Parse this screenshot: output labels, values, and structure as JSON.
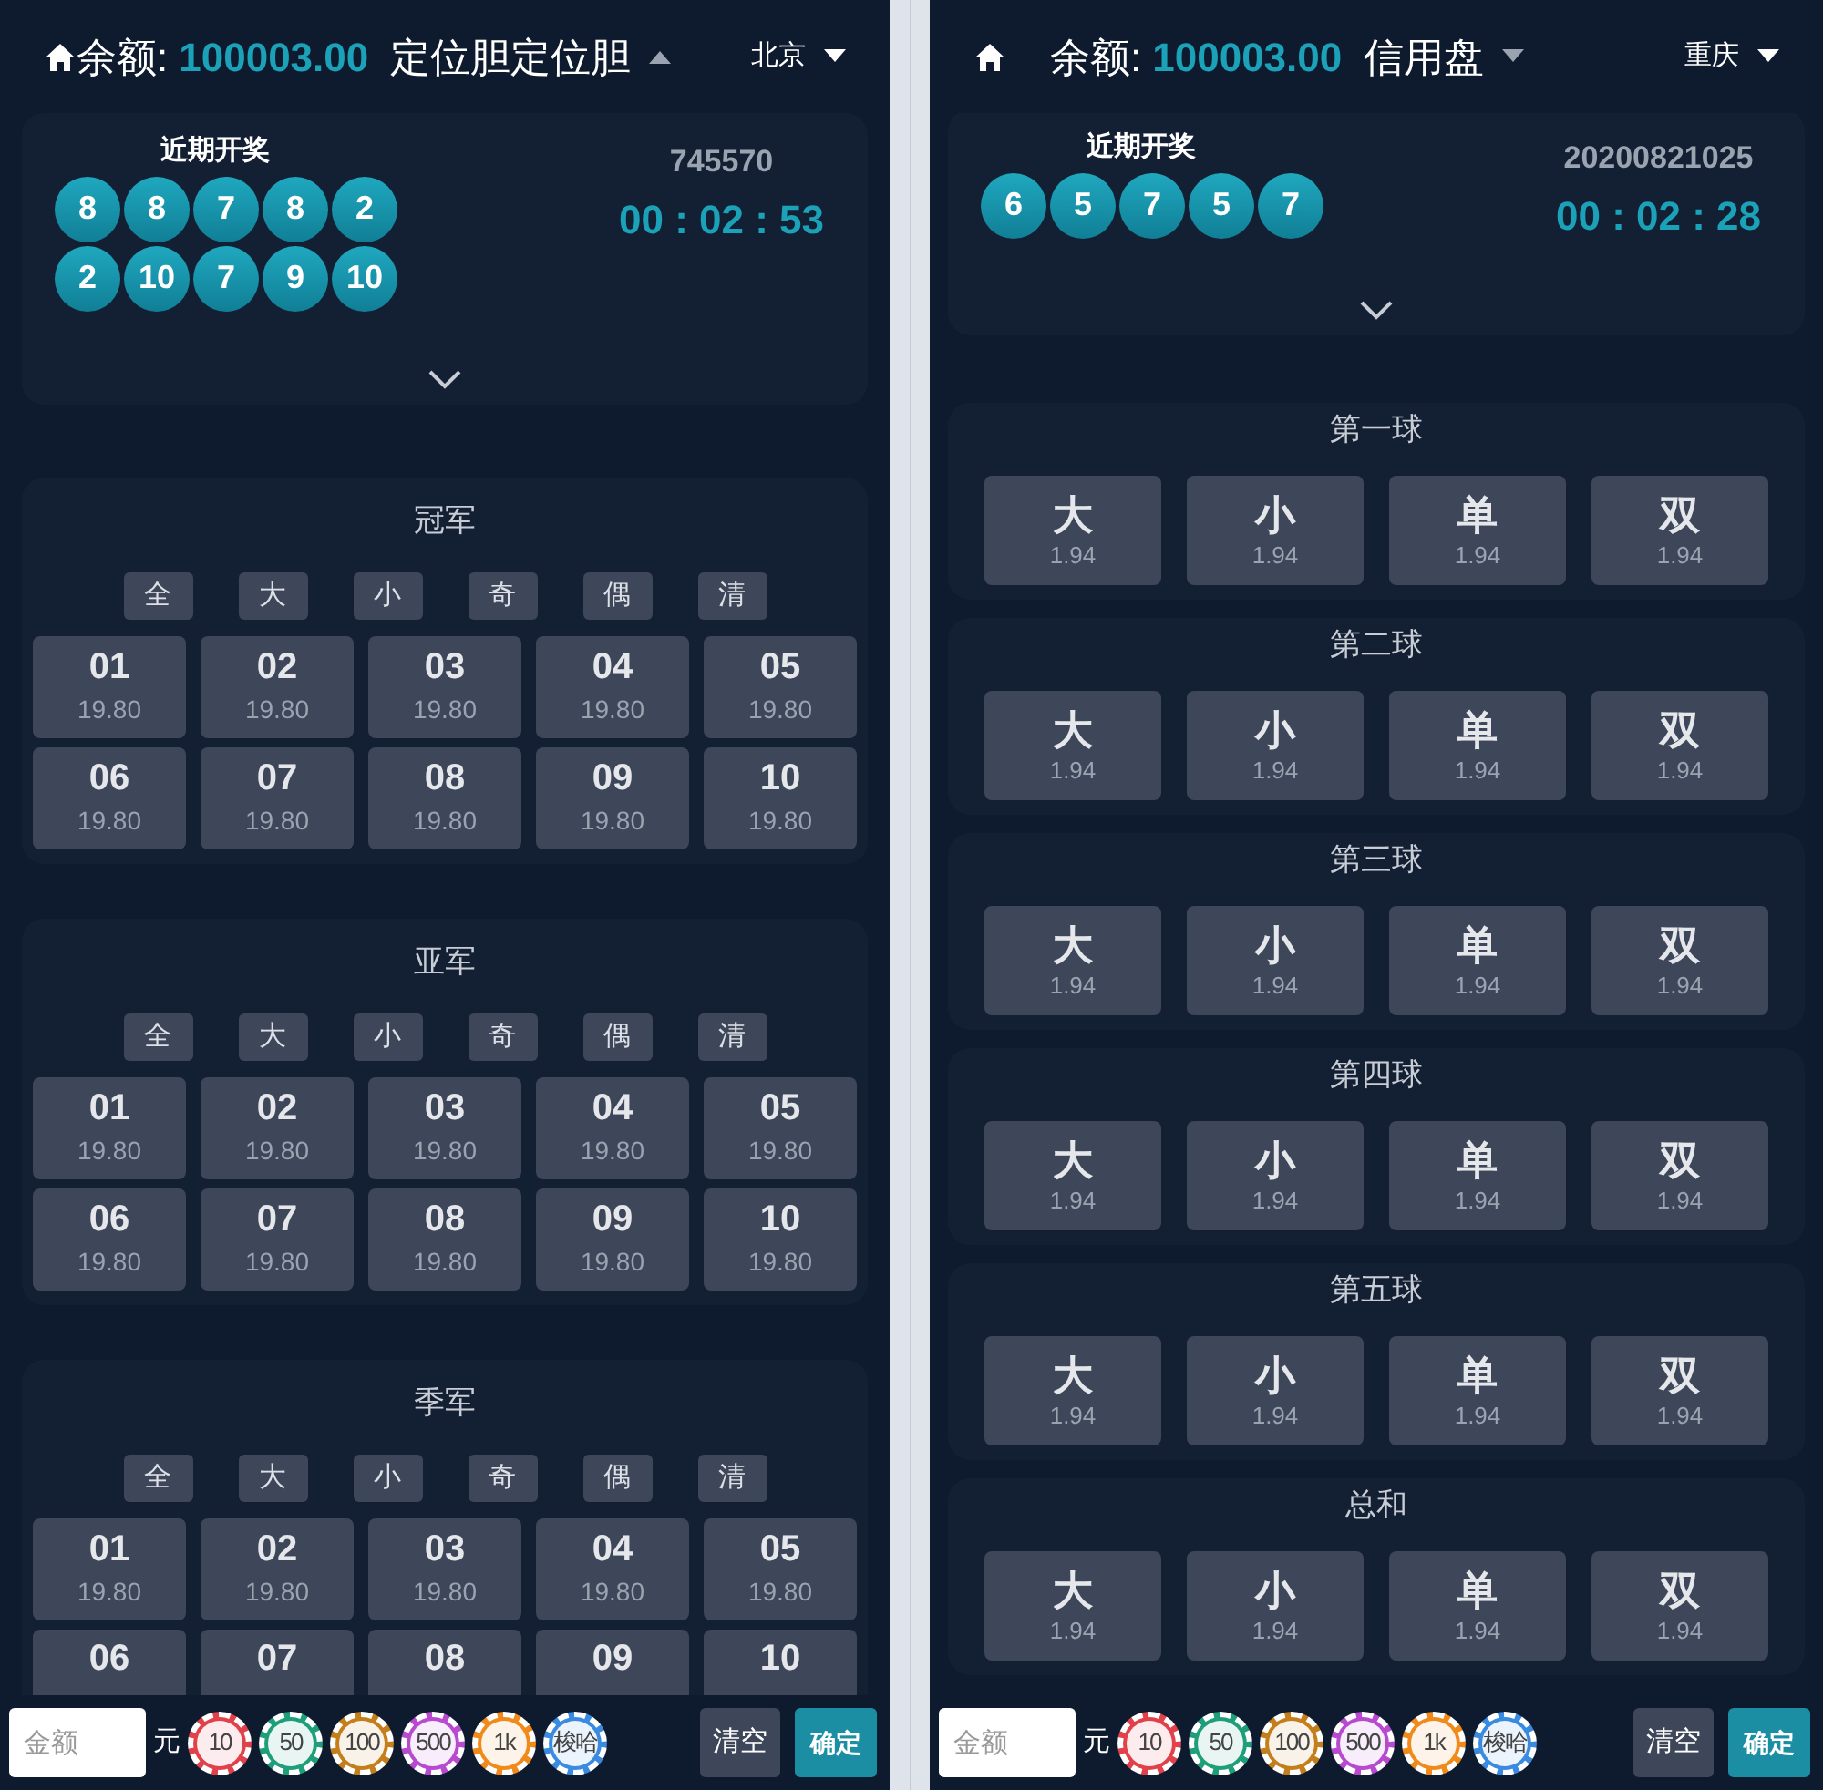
{
  "screens": [
    {
      "header": {
        "balance_label": "余额:",
        "balance": "100003.00",
        "mode": "定位胆定位胆",
        "mode_menu_expanded": true,
        "city": "北京"
      },
      "draw": {
        "title": "近期开奖",
        "numbers": [
          "8",
          "8",
          "7",
          "8",
          "2",
          "2",
          "10",
          "7",
          "9",
          "10"
        ],
        "issue": "745570",
        "countdown": "00 : 02 : 53"
      },
      "sections": [
        {
          "kind": "grid",
          "title": "冠军",
          "quick": [
            "全",
            "大",
            "小",
            "奇",
            "偶",
            "清"
          ],
          "options": [
            {
              "label": "01",
              "odds": "19.80"
            },
            {
              "label": "02",
              "odds": "19.80"
            },
            {
              "label": "03",
              "odds": "19.80"
            },
            {
              "label": "04",
              "odds": "19.80"
            },
            {
              "label": "05",
              "odds": "19.80"
            },
            {
              "label": "06",
              "odds": "19.80"
            },
            {
              "label": "07",
              "odds": "19.80"
            },
            {
              "label": "08",
              "odds": "19.80"
            },
            {
              "label": "09",
              "odds": "19.80"
            },
            {
              "label": "10",
              "odds": "19.80"
            }
          ]
        },
        {
          "kind": "grid",
          "title": "亚军",
          "quick": [
            "全",
            "大",
            "小",
            "奇",
            "偶",
            "清"
          ],
          "options": [
            {
              "label": "01",
              "odds": "19.80"
            },
            {
              "label": "02",
              "odds": "19.80"
            },
            {
              "label": "03",
              "odds": "19.80"
            },
            {
              "label": "04",
              "odds": "19.80"
            },
            {
              "label": "05",
              "odds": "19.80"
            },
            {
              "label": "06",
              "odds": "19.80"
            },
            {
              "label": "07",
              "odds": "19.80"
            },
            {
              "label": "08",
              "odds": "19.80"
            },
            {
              "label": "09",
              "odds": "19.80"
            },
            {
              "label": "10",
              "odds": "19.80"
            }
          ]
        },
        {
          "kind": "grid",
          "title": "季军",
          "quick": [
            "全",
            "大",
            "小",
            "奇",
            "偶",
            "清"
          ],
          "options": [
            {
              "label": "01",
              "odds": "19.80"
            },
            {
              "label": "02",
              "odds": "19.80"
            },
            {
              "label": "03",
              "odds": "19.80"
            },
            {
              "label": "04",
              "odds": "19.80"
            },
            {
              "label": "05",
              "odds": "19.80"
            },
            {
              "label": "06"
            },
            {
              "label": "07"
            },
            {
              "label": "08"
            },
            {
              "label": "09"
            },
            {
              "label": "10"
            }
          ]
        }
      ],
      "bottom": {
        "placeholder": "金额",
        "unit": "元",
        "chips": [
          {
            "label": "10",
            "color": "#e0414b"
          },
          {
            "label": "50",
            "color": "#1f9e7a"
          },
          {
            "label": "100",
            "color": "#c47f1c"
          },
          {
            "label": "500",
            "color": "#b84ad0"
          },
          {
            "label": "1k",
            "color": "#f08a1a"
          },
          {
            "label": "梭哈",
            "color": "#3a8ae0"
          }
        ],
        "clear": "清空",
        "confirm": "确定"
      }
    },
    {
      "header": {
        "balance_label": "余额:",
        "balance": "100003.00",
        "mode": "信用盘",
        "mode_menu_expanded": false,
        "city": "重庆"
      },
      "draw": {
        "title": "近期开奖",
        "numbers": [
          "6",
          "5",
          "7",
          "5",
          "7"
        ],
        "issue": "20200821025",
        "countdown": "00 : 02 : 28"
      },
      "sections": [
        {
          "kind": "row",
          "title": "第一球",
          "options": [
            {
              "label": "大",
              "odds": "1.94"
            },
            {
              "label": "小",
              "odds": "1.94"
            },
            {
              "label": "单",
              "odds": "1.94"
            },
            {
              "label": "双",
              "odds": "1.94"
            }
          ]
        },
        {
          "kind": "row",
          "title": "第二球",
          "options": [
            {
              "label": "大",
              "odds": "1.94"
            },
            {
              "label": "小",
              "odds": "1.94"
            },
            {
              "label": "单",
              "odds": "1.94"
            },
            {
              "label": "双",
              "odds": "1.94"
            }
          ]
        },
        {
          "kind": "row",
          "title": "第三球",
          "options": [
            {
              "label": "大",
              "odds": "1.94"
            },
            {
              "label": "小",
              "odds": "1.94"
            },
            {
              "label": "单",
              "odds": "1.94"
            },
            {
              "label": "双",
              "odds": "1.94"
            }
          ]
        },
        {
          "kind": "row",
          "title": "第四球",
          "options": [
            {
              "label": "大",
              "odds": "1.94"
            },
            {
              "label": "小",
              "odds": "1.94"
            },
            {
              "label": "单",
              "odds": "1.94"
            },
            {
              "label": "双",
              "odds": "1.94"
            }
          ]
        },
        {
          "kind": "row",
          "title": "第五球",
          "options": [
            {
              "label": "大",
              "odds": "1.94"
            },
            {
              "label": "小",
              "odds": "1.94"
            },
            {
              "label": "单",
              "odds": "1.94"
            },
            {
              "label": "双",
              "odds": "1.94"
            }
          ]
        },
        {
          "kind": "row",
          "title": "总和",
          "options": [
            {
              "label": "大",
              "odds": "1.94"
            },
            {
              "label": "小",
              "odds": "1.94"
            },
            {
              "label": "单",
              "odds": "1.94"
            },
            {
              "label": "双",
              "odds": "1.94"
            }
          ]
        }
      ],
      "bottom": {
        "placeholder": "金额",
        "unit": "元",
        "chips": [
          {
            "label": "10",
            "color": "#e0414b"
          },
          {
            "label": "50",
            "color": "#1f9e7a"
          },
          {
            "label": "100",
            "color": "#c47f1c"
          },
          {
            "label": "500",
            "color": "#b84ad0"
          },
          {
            "label": "1k",
            "color": "#f08a1a"
          },
          {
            "label": "梭哈",
            "color": "#3a8ae0"
          }
        ],
        "clear": "清空",
        "confirm": "确定"
      }
    }
  ]
}
